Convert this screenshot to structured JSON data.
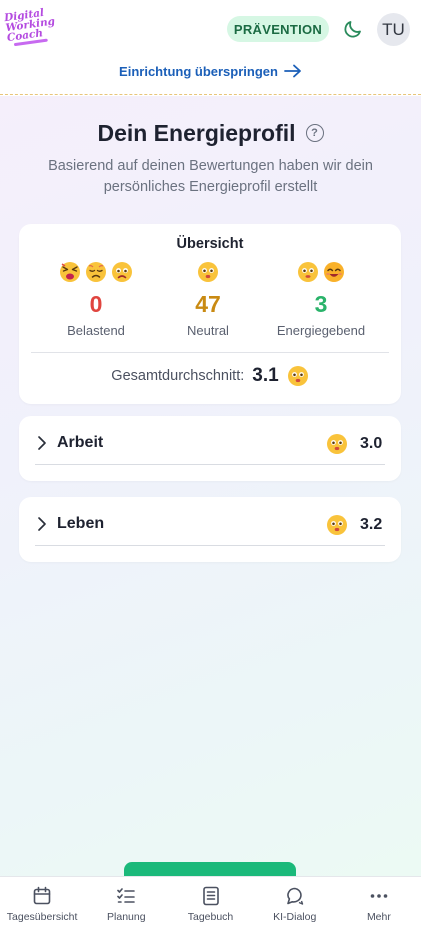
{
  "header": {
    "logo_lines": [
      "Digital",
      "Working",
      "Coach"
    ],
    "badge": "PRÄVENTION",
    "theme_icon": "moon-icon",
    "avatar_initials": "TU",
    "skip_link": "Einrichtung überspringen",
    "skip_icon": "arrow-right-icon"
  },
  "main": {
    "title": "Dein Energieprofil",
    "help_icon": "?",
    "subtitle": "Basierend auf deinen Bewertungen haben wir dein persönliches Energieprofil erstellt"
  },
  "overview": {
    "title": "Übersicht",
    "columns": [
      {
        "emojis": [
          "exhausted-face-icon",
          "sad-face-icon",
          "worried-face-icon"
        ],
        "count": "0",
        "label": "Belastend",
        "color": "#e0453f"
      },
      {
        "emojis": [
          "neutral-face-icon"
        ],
        "count": "47",
        "label": "Neutral",
        "color": "#c98a12"
      },
      {
        "emojis": [
          "slight-smile-face-icon",
          "happy-face-icon"
        ],
        "count": "3",
        "label": "Energiegebend",
        "color": "#2ab36a"
      }
    ],
    "average_label": "Gesamtdurchschnitt:",
    "average_value": "3.1",
    "average_emoji": "neutral-face-icon"
  },
  "sections": [
    {
      "label": "Arbeit",
      "value": "3.0",
      "emoji": "neutral-face-icon"
    },
    {
      "label": "Leben",
      "value": "3.2",
      "emoji": "neutral-face-icon"
    }
  ],
  "bottom_nav": [
    {
      "label": "Tagesübersicht",
      "icon": "calendar-icon"
    },
    {
      "label": "Planung",
      "icon": "checklist-icon"
    },
    {
      "label": "Tagebuch",
      "icon": "journal-icon"
    },
    {
      "label": "KI-Dialog",
      "icon": "chat-bubbles-icon"
    },
    {
      "label": "Mehr",
      "icon": "more-dots-icon"
    }
  ],
  "colors": {
    "accent_blue": "#1b5fb8",
    "badge_bg": "#d6f7e4",
    "badge_text": "#1b6b43",
    "primary_green": "#1bb97a"
  }
}
